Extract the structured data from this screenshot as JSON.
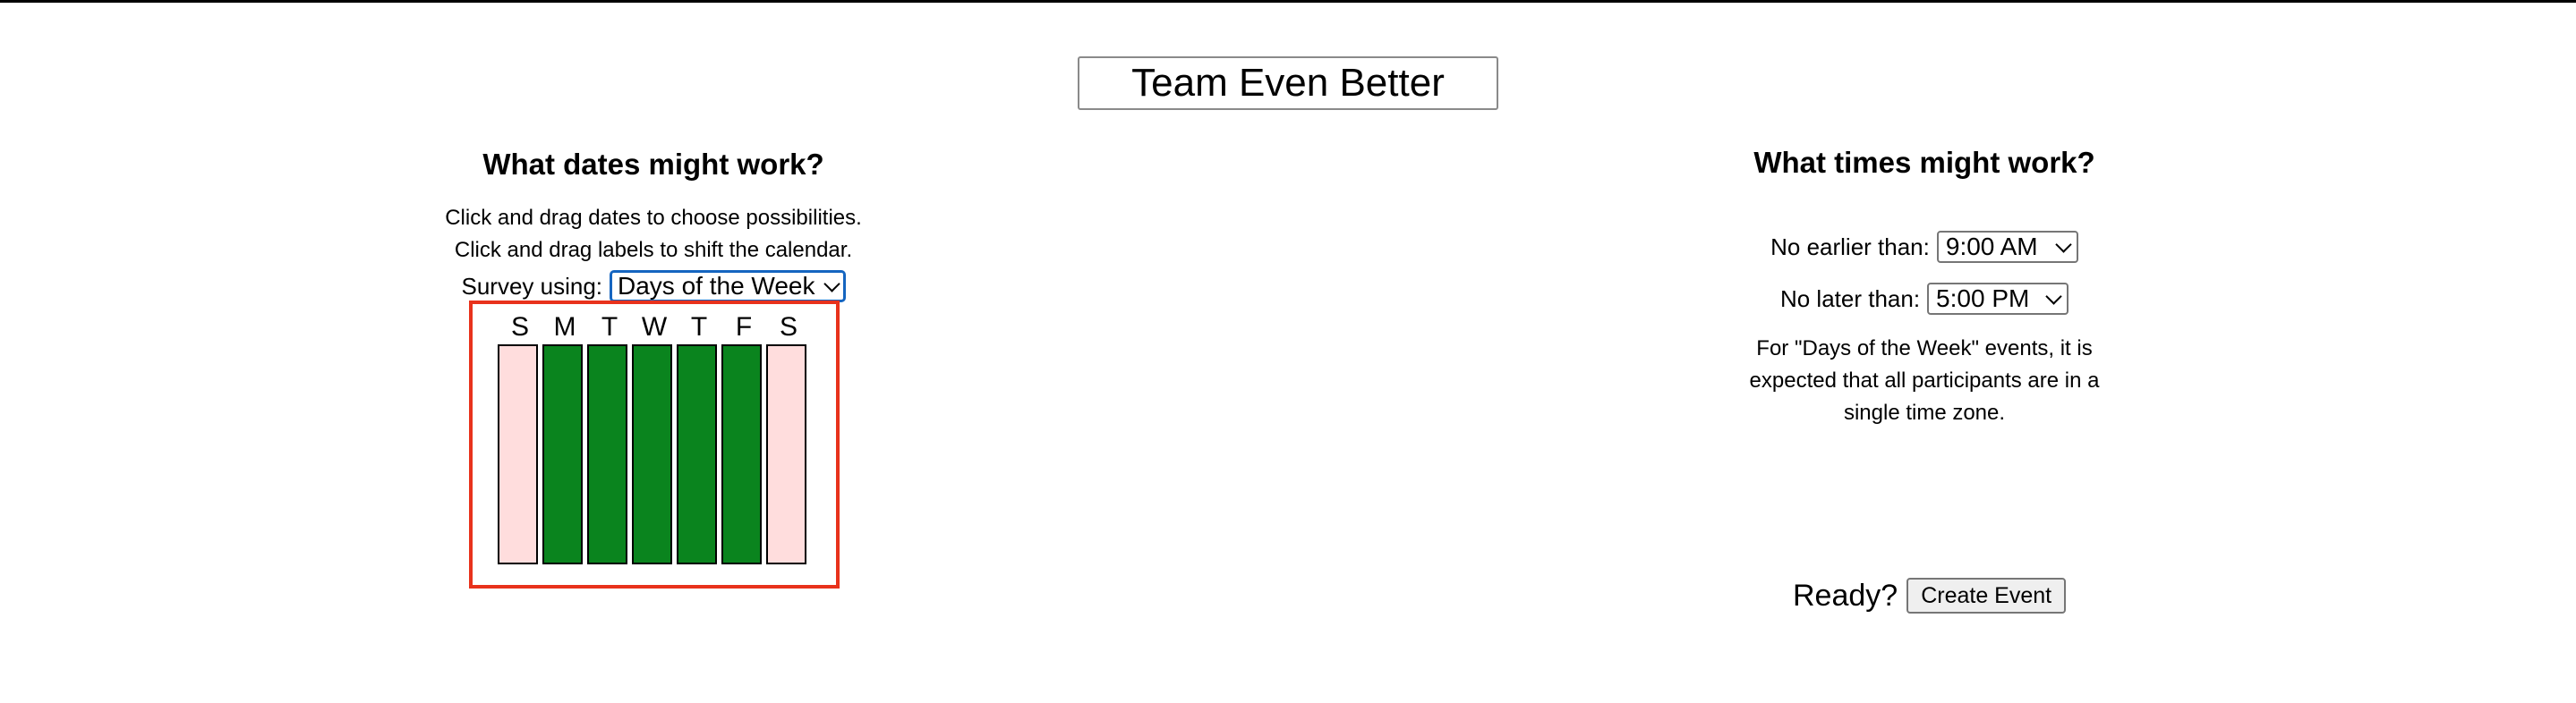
{
  "event": {
    "title": "Team Even Better"
  },
  "dates": {
    "heading": "What dates might work?",
    "instruction_1": "Click and drag dates to choose possibilities.",
    "instruction_2": "Click and drag labels to shift the calendar.",
    "survey_label": "Survey using:",
    "survey_value": "Days of the Week",
    "days": [
      {
        "label": "S",
        "selected": false
      },
      {
        "label": "M",
        "selected": true
      },
      {
        "label": "T",
        "selected": true
      },
      {
        "label": "W",
        "selected": true
      },
      {
        "label": "T",
        "selected": true
      },
      {
        "label": "F",
        "selected": true
      },
      {
        "label": "S",
        "selected": false
      }
    ],
    "colors": {
      "selected": "#0a841e",
      "unselected": "#ffdddd",
      "frame": "#e8321c"
    }
  },
  "times": {
    "heading": "What times might work?",
    "earliest_label": "No earlier than:",
    "earliest_value": "9:00 AM",
    "latest_label": "No later than:",
    "latest_value": "5:00 PM",
    "note_1": "For \"Days of the Week\" events, it is",
    "note_2": "expected that all participants are in a",
    "note_3": "single time zone."
  },
  "footer": {
    "ready_label": "Ready?",
    "create_button": "Create Event"
  }
}
